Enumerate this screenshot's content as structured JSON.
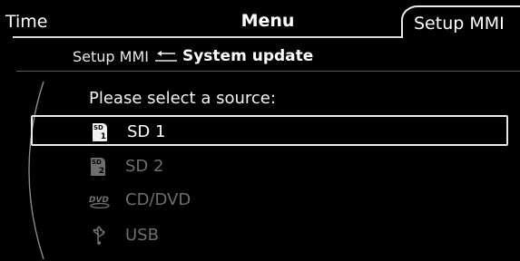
{
  "tabs": {
    "left": "Time",
    "center": "Menu",
    "active": "Setup MMI"
  },
  "breadcrumb": {
    "parent": "Setup MMI",
    "current": "System update"
  },
  "prompt": "Please select a source:",
  "sources": [
    {
      "label": "SD 1",
      "icon": "sd-card-1-icon",
      "state": "selected",
      "badge": "SD",
      "num": "1"
    },
    {
      "label": "SD 2",
      "icon": "sd-card-2-icon",
      "state": "disabled",
      "badge": "SD",
      "num": "2"
    },
    {
      "label": "CD/DVD",
      "icon": "dvd-icon",
      "state": "disabled",
      "badge": "DVD"
    },
    {
      "label": "USB",
      "icon": "usb-icon",
      "state": "disabled"
    }
  ],
  "colors": {
    "background": "#000000",
    "text": "#ffffff",
    "disabled": "#6e6e6e",
    "highlight_border": "#e8e8e8"
  }
}
